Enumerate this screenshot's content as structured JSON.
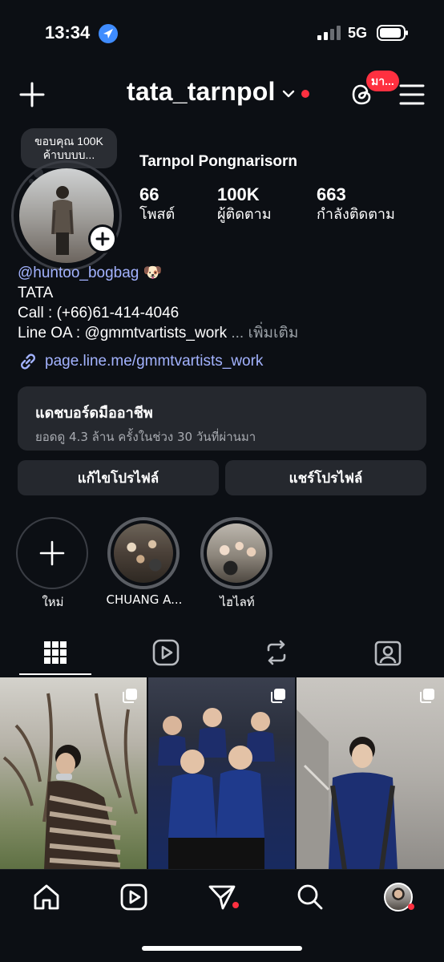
{
  "status_bar": {
    "time": "13:34",
    "network": "5G"
  },
  "header": {
    "username": "tata_tarnpol",
    "threads_badge": "มา..."
  },
  "note": {
    "line1": "ขอบคุณ 100K",
    "line2": "ค้าบบบบ..."
  },
  "profile": {
    "full_name": "Tarnpol Pongnarisorn",
    "stats": [
      {
        "value": "66",
        "label": "โพสต์"
      },
      {
        "value": "100K",
        "label": "ผู้ติดตาม"
      },
      {
        "value": "663",
        "label": "กำลังติดตาม"
      }
    ]
  },
  "bio": {
    "mention": "@huntoo_bogbag",
    "emoji": "🐶",
    "line2": "TATA",
    "line3": "Call : (+66)61-414-4046",
    "line4": "Line OA : @gmmtvartists_work",
    "more": "... เพิ่มเติม",
    "link": "page.line.me/gmmtvartists_work"
  },
  "dashboard": {
    "title": "แดชบอร์ดมืออาชีพ",
    "subtitle": "ยอดดู 4.3 ล้าน ครั้งในช่วง 30 วันที่ผ่านมา"
  },
  "buttons": {
    "edit_profile": "แก้ไขโปรไฟล์",
    "share_profile": "แชร์โปรไฟล์"
  },
  "highlights": [
    {
      "label": "ใหม่"
    },
    {
      "label": "CHUANG A..."
    },
    {
      "label": "ไฮไลท์"
    }
  ],
  "colors": {
    "background": "#0c0f14",
    "accent_link": "#a3b3ff",
    "notification_red": "#ff3040",
    "card": "#25282e"
  }
}
